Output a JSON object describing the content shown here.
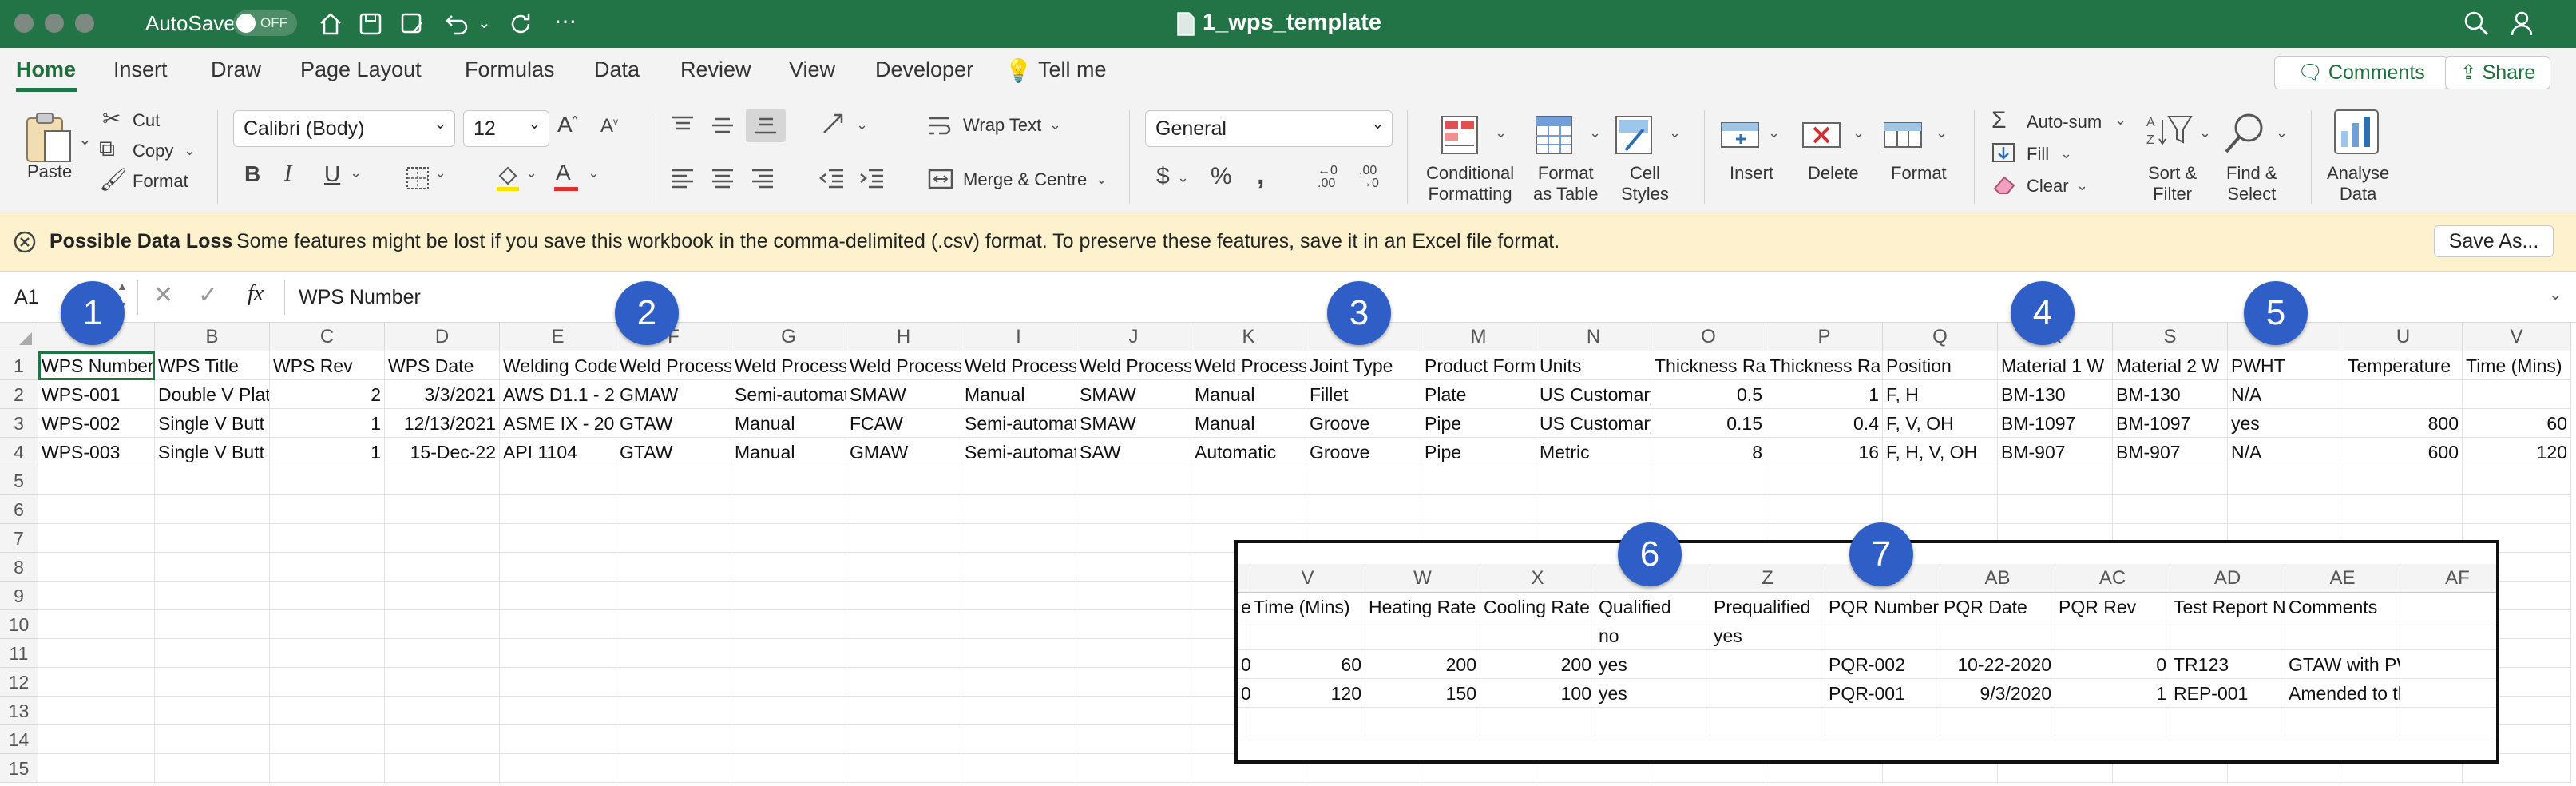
{
  "titlebar": {
    "autosave_label": "AutoSave",
    "autosave_state": "OFF",
    "doc_title": "1_wps_template"
  },
  "tabs": [
    "Home",
    "Insert",
    "Draw",
    "Page Layout",
    "Formulas",
    "Data",
    "Review",
    "View",
    "Developer",
    "Tell me"
  ],
  "top_buttons": {
    "comments": "Comments",
    "share": "Share"
  },
  "ribbon": {
    "paste": "Paste",
    "cut": "Cut",
    "copy": "Copy",
    "format": "Format",
    "font_name": "Calibri (Body)",
    "font_size": "12",
    "wrap_text": "Wrap Text",
    "merge_centre": "Merge & Centre",
    "number_format": "General",
    "conditional_formatting": [
      "Conditional",
      "Formatting"
    ],
    "format_as_table": [
      "Format",
      "as Table"
    ],
    "cell_styles": [
      "Cell",
      "Styles"
    ],
    "insert": "Insert",
    "delete": "Delete",
    "format_cells": "Format",
    "autosum": "Auto-sum",
    "fill": "Fill",
    "clear": "Clear",
    "sort_filter": [
      "Sort &",
      "Filter"
    ],
    "find_select": [
      "Find &",
      "Select"
    ],
    "analyse_data": [
      "Analyse",
      "Data"
    ]
  },
  "message_bar": {
    "title": "Possible Data Loss",
    "text": "Some features might be lost if you save this workbook in the comma-delimited (.csv) format. To preserve these features, save it in an Excel file format.",
    "button": "Save As..."
  },
  "formula_bar": {
    "name_box": "A1",
    "fx": "fx",
    "content": "WPS Number"
  },
  "columns": [
    "A",
    "B",
    "C",
    "D",
    "E",
    "F",
    "G",
    "H",
    "I",
    "J",
    "K",
    "L",
    "M",
    "N",
    "O",
    "P",
    "Q",
    "R",
    "S",
    "T",
    "U",
    "V"
  ],
  "row_numbers": [
    "1",
    "2",
    "3",
    "4",
    "5",
    "6",
    "7",
    "8",
    "9",
    "10",
    "11",
    "12",
    "13",
    "14",
    "15"
  ],
  "rows": [
    [
      "WPS Number",
      "WPS Title",
      "WPS Rev",
      "WPS Date",
      "Welding Code",
      "Weld Process",
      "Weld Process",
      "Weld Process",
      "Weld Process",
      "Weld Process",
      "Weld Process",
      "Joint Type",
      "Product Form",
      "Units",
      "Thickness Range",
      "Thickness Range",
      "Position",
      "Material 1 W",
      "Material 2 W",
      "PWHT",
      "Temperature",
      "Time (Mins)"
    ],
    [
      "WPS-001",
      "Double V Plate",
      "2",
      "3/3/2021",
      "AWS D1.1 - 2",
      "GMAW",
      "Semi-automatic",
      "SMAW",
      "Manual",
      "SMAW",
      "Manual",
      "Fillet",
      "Plate",
      "US Customary",
      "0.5",
      "1",
      "F, H",
      "BM-130",
      "BM-130",
      "N/A",
      "",
      ""
    ],
    [
      "WPS-002",
      "Single V Butt",
      "1",
      "12/13/2021",
      "ASME IX - 20",
      "GTAW",
      "Manual",
      "FCAW",
      "Semi-automatic",
      "SMAW",
      "Manual",
      "Groove",
      "Pipe",
      "US Customary",
      "0.15",
      "0.4",
      "F, V, OH",
      "BM-1097",
      "BM-1097",
      "yes",
      "800",
      "60"
    ],
    [
      "WPS-003",
      "Single V Butt",
      "1",
      "15-Dec-22",
      "API 1104",
      "GTAW",
      "Manual",
      "GMAW",
      "Semi-automatic",
      "SAW",
      "Automatic",
      "Groove",
      "Pipe",
      "Metric",
      "8",
      "16",
      "F, H, V, OH",
      "BM-907",
      "BM-907",
      "N/A",
      "600",
      "120"
    ]
  ],
  "right_align_cols": [
    2,
    3,
    14,
    15,
    20,
    21
  ],
  "badges": [
    "1",
    "2",
    "3",
    "4",
    "5",
    "6",
    "7"
  ],
  "inset": {
    "columns": [
      "V",
      "W",
      "X",
      "Y",
      "Z",
      "AA",
      "AB",
      "AC",
      "AD",
      "AE",
      "AF"
    ],
    "row_numbers": [
      "9",
      "10",
      "11",
      "12",
      "13",
      "14",
      "15"
    ],
    "rows": [
      [
        "e",
        "Time (Mins)",
        "Heating Rate",
        "Cooling Rate",
        "Qualified",
        "Prequalified",
        "PQR Number",
        "PQR Date",
        "PQR Rev",
        "Test Report N",
        "Comments",
        ""
      ],
      [
        "",
        "",
        "",
        "",
        "no",
        "yes",
        "",
        "",
        "",
        "",
        "",
        ""
      ],
      [
        "0",
        "60",
        "200",
        "200",
        "yes",
        "",
        "PQR-002",
        "10-22-2020",
        "0",
        "TR123",
        "GTAW with PWHT",
        ""
      ],
      [
        "0",
        "120",
        "150",
        "100",
        "yes",
        "",
        "PQR-001",
        "9/3/2020",
        "1",
        "REP-001",
        "Amended to the new revision",
        ""
      ],
      [
        "",
        "",
        "",
        "",
        "",
        "",
        "",
        "",
        "",
        "",
        "",
        ""
      ]
    ]
  },
  "colors": {
    "excel_green": "#227447",
    "badge_blue": "#2f5fc6",
    "warning_bg": "#fdf2cd"
  }
}
